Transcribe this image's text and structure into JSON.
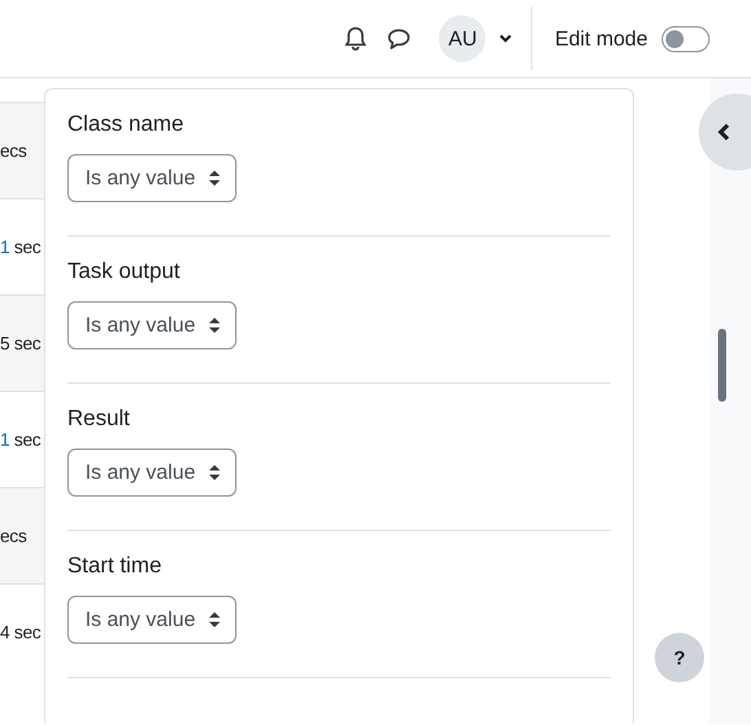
{
  "header": {
    "avatar": "AU",
    "edit_mode": {
      "label": "Edit mode",
      "on": false
    }
  },
  "table": {
    "rows": [
      {
        "link": "",
        "text": "ecs"
      },
      {
        "link": "1",
        "text": "sec"
      },
      {
        "link": "",
        "text": "5 sec"
      },
      {
        "link": "1",
        "text": "sec"
      },
      {
        "link": "",
        "text": "ecs"
      },
      {
        "link": "",
        "text": "4 sec"
      }
    ]
  },
  "filters": [
    {
      "label": "Class name",
      "value": "Is any value"
    },
    {
      "label": "Task output",
      "value": "Is any value"
    },
    {
      "label": "Result",
      "value": "Is any value"
    },
    {
      "label": "Start time",
      "value": "Is any value"
    }
  ],
  "help": "?"
}
